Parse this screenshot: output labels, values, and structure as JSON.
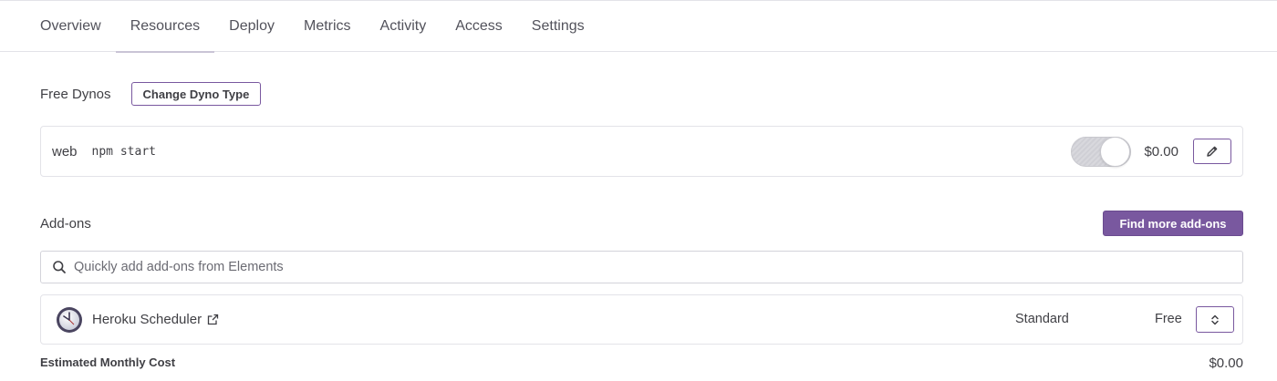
{
  "tabs": [
    {
      "label": "Overview"
    },
    {
      "label": "Resources"
    },
    {
      "label": "Deploy"
    },
    {
      "label": "Metrics"
    },
    {
      "label": "Activity"
    },
    {
      "label": "Access"
    },
    {
      "label": "Settings"
    }
  ],
  "active_tab": "Resources",
  "dynos": {
    "title": "Free Dynos",
    "change_button": "Change Dyno Type",
    "row": {
      "type": "web",
      "command": "npm start",
      "enabled": true,
      "cost": "$0.00",
      "edit_icon": "pencil-icon"
    }
  },
  "addons": {
    "title": "Add-ons",
    "find_button": "Find more add-ons",
    "search": {
      "placeholder": "Quickly add add-ons from Elements",
      "icon": "search-icon"
    },
    "items": [
      {
        "name": "Heroku Scheduler",
        "icon": "clock-icon",
        "link_icon": "external-link-icon",
        "plan": "Standard",
        "price": "Free",
        "select_icon": "chevron-updown-icon"
      }
    ]
  },
  "estimate": {
    "label": "Estimated Monthly Cost",
    "value": "$0.00"
  },
  "colors": {
    "accent": "#79589f",
    "border": "#e3e3e8",
    "text": "#3f3f44"
  }
}
